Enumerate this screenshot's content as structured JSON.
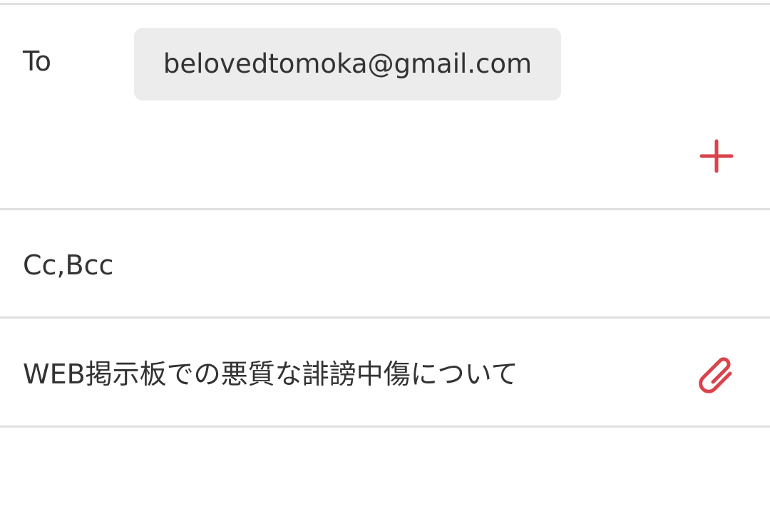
{
  "to_field": {
    "label": "To",
    "recipients": [
      "belovedtomoka@gmail.com"
    ]
  },
  "cc_bcc": {
    "label": "Cc,Bcc"
  },
  "subject": {
    "value": "WEB掲示板での悪質な誹謗中傷について"
  },
  "icons": {
    "add": "plus-icon",
    "attach": "paperclip-icon"
  },
  "colors": {
    "accent": "#d9434b",
    "chip_bg": "#ececec",
    "divider": "#e0e0e0",
    "text": "#333333"
  }
}
